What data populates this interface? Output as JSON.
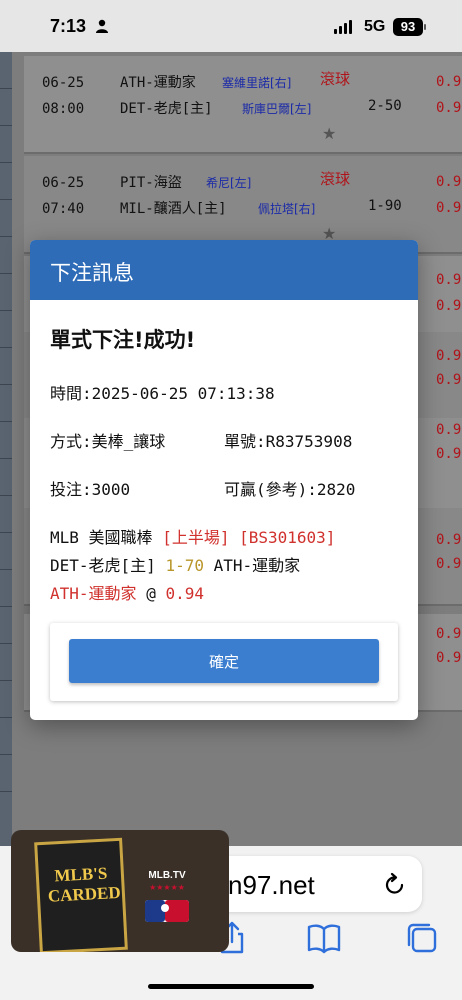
{
  "status_bar": {
    "time": "7:13",
    "network": "5G",
    "battery": "93"
  },
  "games": [
    {
      "date": "06-25",
      "time": "08:00",
      "away_team": "ATH-運動家",
      "away_pitcher": "塞維里諾[右]",
      "home_team": "DET-老虎[主]",
      "home_pitcher": "斯庫巴爾[左]",
      "live_label": "滾球",
      "line": "2-50",
      "odds_top": "0.9",
      "odds_bottom": "0.9"
    },
    {
      "date": "06-25",
      "time": "07:40",
      "away_team": "PIT-海盜",
      "away_pitcher": "希尼[左]",
      "home_team": "MIL-釀酒人[主]",
      "home_pitcher": "佩拉塔[右]",
      "live_label": "滾球",
      "line": "1-90",
      "odds_top": "0.9",
      "odds_bottom": "0.9"
    }
  ],
  "side_odds": [
    "0.9",
    "0.9",
    "0.9",
    "0.9",
    "0.9",
    "0.9",
    "0.9",
    "0.9",
    "0.9",
    "0.9"
  ],
  "modal": {
    "title": "下注訊息",
    "success": "單式下注!成功!",
    "time_line": "時間:2025-06-25 07:13:38",
    "method": "方式:美棒_讓球",
    "ticket": "單號:R83753908",
    "stake": "投注:3000",
    "win": "可贏(參考):2820",
    "league": "MLB 美國職棒",
    "half": "[上半場]",
    "code": "[BS301603]",
    "home": "DET-老虎[主]",
    "handicap": "1-70",
    "away": "ATH-運動家",
    "pick": "ATH-運動家",
    "at": "@",
    "odds": "0.94",
    "confirm": "確定"
  },
  "browser": {
    "url": "n97.net"
  },
  "pip": {
    "card_text": "MLB'S CARDED",
    "logo_text": "MLB.TV"
  }
}
